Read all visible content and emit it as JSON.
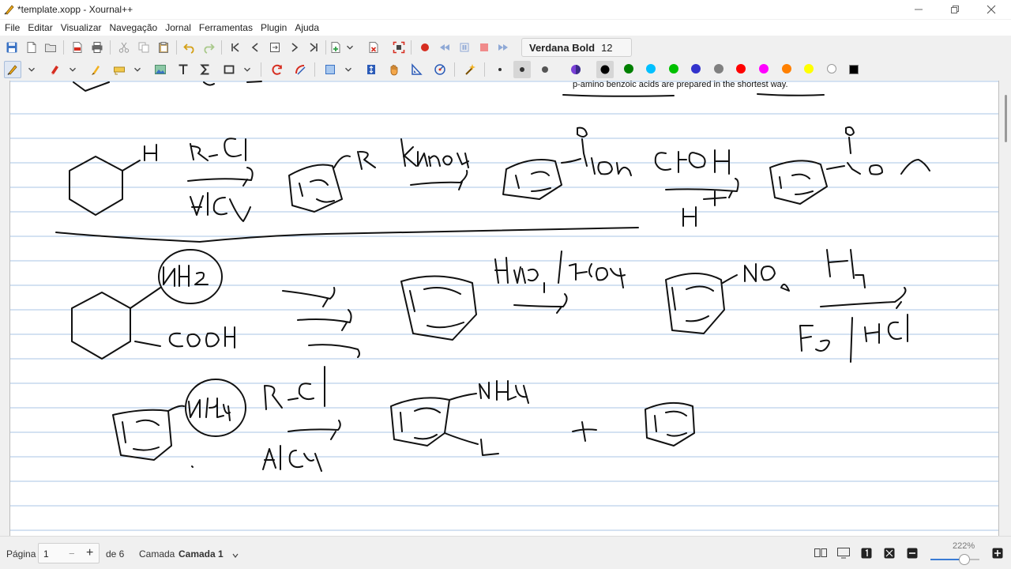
{
  "window": {
    "title": "*template.xopp - Xournal++"
  },
  "menu": {
    "items": [
      "File",
      "Editar",
      "Visualizar",
      "Navegação",
      "Jornal",
      "Ferramentas",
      "Plugin",
      "Ajuda"
    ]
  },
  "toolbar": {
    "font_name": "Verdana Bold",
    "font_size": "12"
  },
  "colors": {
    "palette": [
      "#000000",
      "#008000",
      "#00c0ff",
      "#00c000",
      "#3333cc",
      "#808080",
      "#ff0000",
      "#ff00ff",
      "#ff8000",
      "#ffff00",
      "#ffffff",
      "#000000"
    ],
    "selected_color": "#000000",
    "ruling": "#a8c6e6",
    "accent": "#3a7bd5"
  },
  "document": {
    "pdf_text": "p-amino benzoic acids are prepared in the shortest way."
  },
  "status": {
    "page_label": "Página",
    "page_value": "1",
    "page_total": "de 6",
    "layer_label": "Camada",
    "layer_value": "Camada 1",
    "zoom": "222%"
  }
}
